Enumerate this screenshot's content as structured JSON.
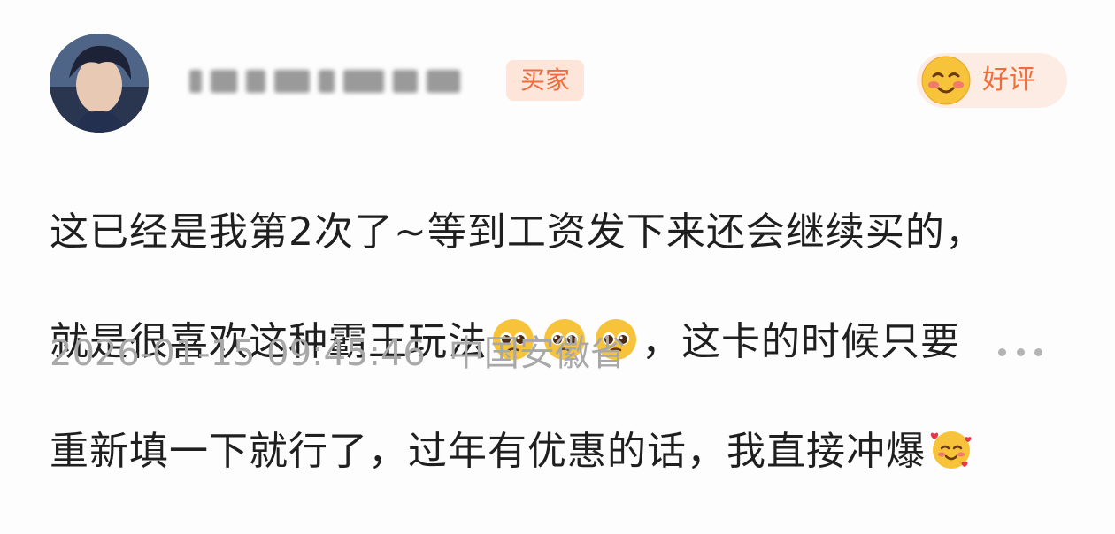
{
  "review": {
    "role_badge": "买家",
    "rating_label": "好评",
    "rating_icon": "blushing-smile-icon",
    "comment_lines": {
      "l1": "这已经是我第2次了~等到工资发下来还会继续买的，",
      "l2a": "就是很喜欢这种霸王玩法",
      "l2b": "，这卡的时候只要",
      "l3": "重新填一下就行了，过年有优惠的话，我直接冲爆"
    },
    "inline_emojis": [
      "pleading-face-icon",
      "pleading-face-icon",
      "pleading-face-icon",
      "smiling-face-with-hearts-icon"
    ],
    "timestamp": "2026-01-15 09:45:46",
    "location": "中国安徽省",
    "more_icon": "more-dots-icon"
  },
  "colors": {
    "accent": "#ef6d3a",
    "badge_bg": "#fde6d9",
    "text": "#1f1f1f",
    "meta": "#a8a8a8"
  }
}
